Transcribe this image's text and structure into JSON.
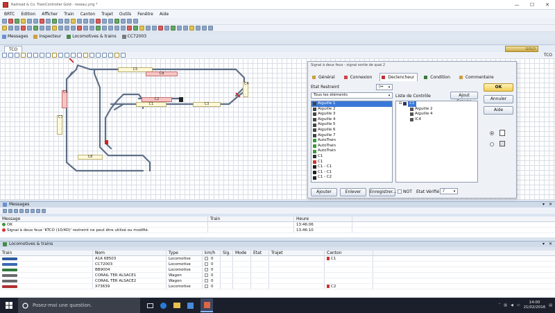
{
  "window": {
    "title": "Railroad & Co. TrainController Gold - reseau.yrrg *",
    "min": "—",
    "max": "☐",
    "close": "✕"
  },
  "menu": [
    "BRTC",
    "Edition",
    "Afficher",
    "Train",
    "Canton",
    "Trajet",
    "Outils",
    "Fenêtre",
    "Aide"
  ],
  "doctabs": [
    {
      "label": "Messages",
      "color": "#6a8fd0"
    },
    {
      "label": "Inspecteur",
      "color": "#d0a040"
    },
    {
      "label": "Locomotives & trains",
      "color": "#4a8a4a"
    },
    {
      "label": "CC72003",
      "color": "#7a7a7a"
    }
  ],
  "tco": {
    "tab": "TCO",
    "brand": "GOLD",
    "label": "TCO"
  },
  "track_labels": [
    {
      "text": "C5",
      "red": false
    },
    {
      "text": "C9",
      "red": true
    },
    {
      "text": "C6",
      "red": true
    },
    {
      "text": "C2",
      "red": false
    },
    {
      "text": "C1",
      "red": false
    },
    {
      "text": "C3",
      "red": false
    },
    {
      "text": "C4",
      "red": false
    },
    {
      "text": "C7",
      "red": false
    },
    {
      "text": "C8",
      "red": false
    }
  ],
  "dialog": {
    "title": "Signal à deux feux - signal sortie de quai 2",
    "tabs": [
      "Général",
      "Connexion",
      "Declencheur",
      "Condition",
      "Commentaire"
    ],
    "active_tab": "Declencheur",
    "etat_restreint_label": "Etat Restreint",
    "etat_restreint_value": "|↔",
    "filter_value": "Tous les éléments",
    "source_items": [
      {
        "label": "Aiguille 1",
        "icon": "switch-icon",
        "selected": true
      },
      {
        "label": "Aiguille 2",
        "icon": "switch-icon"
      },
      {
        "label": "Aiguille 3",
        "icon": "switch-icon"
      },
      {
        "label": "Aiguille 4",
        "icon": "switch-icon"
      },
      {
        "label": "Aiguille 5",
        "icon": "switch-icon"
      },
      {
        "label": "Aiguille 6",
        "icon": "switch-icon"
      },
      {
        "label": "Aiguille 7",
        "icon": "switch-icon"
      },
      {
        "label": "AutoTrain",
        "icon": "autotrain-icon"
      },
      {
        "label": "AutoTrain",
        "icon": "autotrain-icon"
      },
      {
        "label": "AutoTrain",
        "icon": "autotrain-icon"
      },
      {
        "label": "C1",
        "icon": "block-icon"
      },
      {
        "label": "C1",
        "icon": "block-red-icon"
      },
      {
        "label": "C1 - C1",
        "icon": "route-icon"
      },
      {
        "label": "C1 - C1",
        "icon": "route-icon"
      },
      {
        "label": "C1 - C2",
        "icon": "route-icon"
      }
    ],
    "control_list_label": "Liste de Contrôle",
    "ajout_groupe": "Ajout Groupe",
    "tree": [
      {
        "label": "C1",
        "level": 0,
        "selected": true
      },
      {
        "label": "Aiguille 2",
        "level": 1
      },
      {
        "label": "Aiguille 4",
        "level": 1
      },
      {
        "label": "IC4",
        "level": 1
      }
    ],
    "buttons": {
      "ok": "OK",
      "annuler": "Annuler",
      "aide": "Aide",
      "ajouter": "Ajouter",
      "enlever": "Enlever",
      "enregistrer": "Enregistrer..."
    },
    "not_label": "NOT",
    "etat_verifie_label": "Etat Vérifié",
    "etat_verifie_value": "♪"
  },
  "messages_panel": {
    "title": "Messages",
    "columns": [
      "Message",
      "Train",
      "Heure"
    ],
    "rows": [
      {
        "message": "OK",
        "train": "",
        "heure": "13:46:06",
        "status": "ok"
      },
      {
        "message": "Signal à deux feux 'KTCO (10/4D)' restreint ne peut être utilisé ou modifié.",
        "train": "",
        "heure": "13:46:10",
        "status": "error"
      }
    ]
  },
  "trains_panel": {
    "title": "Locomotives & trains",
    "columns": [
      "Train",
      "Nom",
      "Type",
      "km/h",
      "Sig.",
      "Mode",
      "Etat",
      "Trajet",
      "Canton"
    ],
    "rows": [
      {
        "nom": "A1A 68503",
        "type": "Locomotive",
        "kmh": "0",
        "canton": "C1",
        "loco_color": "#2c5aa0"
      },
      {
        "nom": "CC72003",
        "type": "Locomotive",
        "kmh": "0",
        "canton": "",
        "loco_color": "#3a6ab0"
      },
      {
        "nom": "BB9004",
        "type": "Locomotive",
        "kmh": "0",
        "canton": "",
        "loco_color": "#2f7a3c"
      },
      {
        "nom": "CORAIL TER ALSACE1",
        "type": "Wagon",
        "kmh": "0",
        "canton": "",
        "loco_color": "#6a6a6a"
      },
      {
        "nom": "CORAIL TER ALSACE2",
        "type": "Wagon",
        "kmh": "0",
        "canton": "",
        "loco_color": "#6a6a6a"
      },
      {
        "nom": "X73639",
        "type": "Locomotive",
        "kmh": "0",
        "canton": "C2",
        "loco_color": "#b03030"
      }
    ]
  },
  "taskbar": {
    "search_placeholder": "Posez-moi une question.",
    "time": "14:00",
    "date": "21/02/2016"
  }
}
